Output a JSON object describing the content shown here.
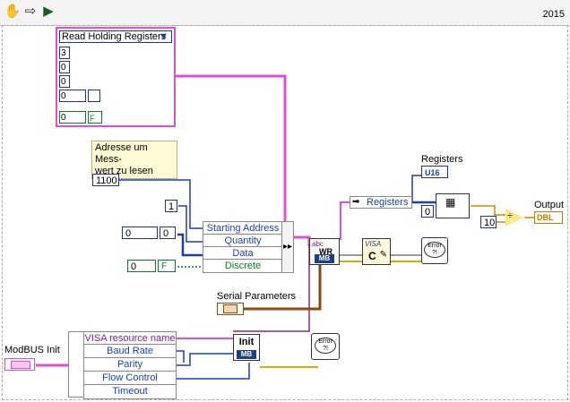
{
  "toolbar": {
    "icons": [
      "hand-icon",
      "arrow-right-icon",
      "run-continuous-icon"
    ],
    "version": "2015"
  },
  "function_cluster": {
    "enum_value": "Read Holding Registers",
    "enum_arrow": "▼",
    "values": [
      "3",
      "0",
      "0",
      "0",
      "0"
    ],
    "bool_value": "F"
  },
  "comment_label": "Adresse um Mess-\nwert zu lesen",
  "constants": {
    "start_address": "1100",
    "quantity": "1",
    "data_array_index": "0",
    "data_value": "0",
    "discrete_array_index": "0",
    "discrete_value": "F",
    "index_zero": "0",
    "ten": "10"
  },
  "bundle_fields": [
    "Starting Address",
    "Quantity",
    "Data",
    "Discrete"
  ],
  "bundle_colors": [
    "#1a3fb0",
    "#1a3fb0",
    "#1a3fb0",
    "#0d7a2a"
  ],
  "registers_label": "Registers",
  "registers_unbundle": "Registers",
  "u16_indicator": "U16",
  "output_label": "Output",
  "output_indicator": "DBL",
  "serial_label": "Serial Parameters",
  "modbus_init_label": "ModBUS Init",
  "init_fields": [
    "VISA resource name",
    "Baud Rate",
    "Parity",
    "Flow Control",
    "Timeout"
  ],
  "init_field_colors": [
    "#7a1f8a",
    "#1a3fb0",
    "#1a3fb0",
    "#1a3fb0",
    "#1a3fb0"
  ],
  "init_vi": {
    "title": "Init",
    "tag": "MB"
  },
  "write_vi": {
    "tag": "MB",
    "text": "WR"
  },
  "visa_close": {
    "text": "VISA",
    "letter": "C"
  },
  "error_label": "Error",
  "error_q": "?!",
  "divide_symbol": "÷"
}
